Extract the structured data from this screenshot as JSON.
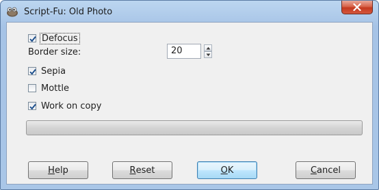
{
  "window": {
    "title": "Script-Fu: Old Photo",
    "app_icon": "gimp-icon",
    "close_icon": "close-icon"
  },
  "options": {
    "defocus": {
      "label": "Defocus",
      "checked": true
    },
    "border_size": {
      "label": "Border size:",
      "value": "20"
    },
    "sepia": {
      "label": "Sepia",
      "checked": true
    },
    "mottle": {
      "label": "Mottle",
      "checked": false
    },
    "work_on_copy": {
      "label": "Work on copy",
      "checked": true
    }
  },
  "progress": {
    "value": 0
  },
  "buttons": {
    "help": {
      "mnemonic": "H",
      "rest": "elp"
    },
    "reset": {
      "mnemonic": "R",
      "rest": "eset"
    },
    "ok": {
      "mnemonic": "O",
      "rest": "K"
    },
    "cancel": {
      "mnemonic": "C",
      "rest": "ancel"
    }
  },
  "colors": {
    "titlebar": "#a9c6e7",
    "close_button": "#c4391f",
    "default_button_border": "#3c7fb1",
    "checkmark": "#1d4f8c"
  }
}
